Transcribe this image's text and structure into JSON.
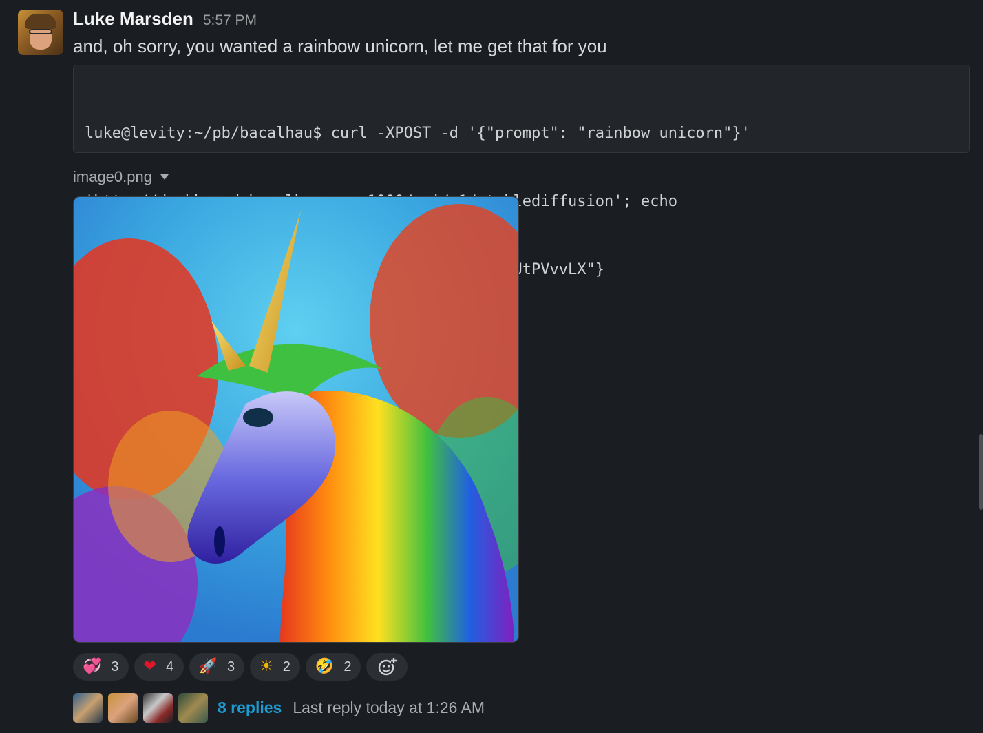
{
  "message": {
    "author": "Luke Marsden",
    "time": "5:57 PM",
    "text": "and, oh sorry, you wanted a rainbow unicorn, let me get that for you",
    "code_lines": [
      "luke@levity:~/pb/bacalhau$ curl -XPOST -d '{\"prompt\": \"rainbow unicorn\"}'",
      "'http://dashboard.bacalhau.org:1000/api/v1/stablediffusion'; echo",
      "{\"cid\": \"QmX9f2HN6kbsh2vUP1PLsZpeUNLUPWMXnyHpduUtPVvvLX\"}"
    ]
  },
  "attachment": {
    "filename": "image0.png",
    "icon": "chevron-down-icon"
  },
  "reactions": [
    {
      "emoji": "💞",
      "icon": "two-hearts-icon",
      "count": "3"
    },
    {
      "emoji": "❤",
      "icon": "heart-icon",
      "count": "4"
    },
    {
      "emoji": "🚀",
      "icon": "rocket-icon",
      "count": "3"
    },
    {
      "emoji": "☀",
      "icon": "sun-icon",
      "count": "2"
    },
    {
      "emoji": "🤣",
      "icon": "rofl-icon",
      "count": "2"
    }
  ],
  "add_reaction_icon": "add-reaction-icon",
  "thread": {
    "replies": "8 replies",
    "last_reply": "Last reply today at 1:26 AM"
  },
  "colors": {
    "background": "#1a1d21",
    "link": "#1d9bd1",
    "reaction_bg": "#2b2e33"
  }
}
